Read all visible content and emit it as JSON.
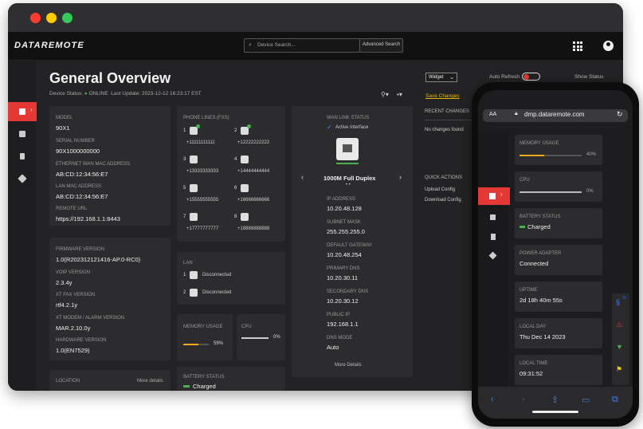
{
  "header": {
    "logo": "DATAREMOTE",
    "search_placeholder": "Device Search...",
    "advanced_search": "Advanced Search"
  },
  "overview": {
    "title": "General Overview",
    "status_label": "Device Status:",
    "status_value": "ONLINE",
    "last_update": "Last Update: 2023-12-12 16:23:17 EST",
    "widget_select": "Widget",
    "save_changes": "Save Changes",
    "auto_refresh": "Auto Refresh",
    "show_status": "Show Status"
  },
  "device": {
    "model_label": "MODEL",
    "model": "90X1",
    "serial_label": "SERIAL NUMBER",
    "serial": "90X1000000000",
    "eth_mac_label": "ETHERNET WAN MAC ADDRESS",
    "eth_mac": "AB:CD:12:34:56:E7",
    "lan_mac_label": "LAN MAC ADDRESS",
    "lan_mac": "AB:CD:12:34:56:E7",
    "remote_url_label": "REMOTE URL",
    "remote_url": "https://192.168.1.1:8443"
  },
  "firmware": {
    "fw_label": "FIRMWARE VERSION",
    "fw": "1.0(R202312121416-AP.0-RC0)",
    "voip_label": "VoIP VERSION",
    "voip": "2.3.4y",
    "fax_label": "XT FAX VERSION",
    "fax": "rtf4.2.1y",
    "modem_label": "XT MODEM / ALARM VERSION",
    "modem": "MAR.2.10.0y",
    "hw_label": "HARDWARE VERSION",
    "hw": "1.0(EN7529)"
  },
  "location": {
    "label": "LOCATION",
    "more": "More details"
  },
  "phone_lines": {
    "title": "PHONE LINES (FXS)",
    "lines": [
      {
        "n": "1",
        "num": "+11111111111"
      },
      {
        "n": "2",
        "num": "+12222222222"
      },
      {
        "n": "3",
        "num": "+13333333333"
      },
      {
        "n": "4",
        "num": "+14444444444"
      },
      {
        "n": "5",
        "num": "+15555555555"
      },
      {
        "n": "6",
        "num": "+16666666666"
      },
      {
        "n": "7",
        "num": "+17777777777"
      },
      {
        "n": "8",
        "num": "+18888888888"
      }
    ]
  },
  "lan": {
    "title": "LAN",
    "ports": [
      {
        "n": "1",
        "status": "Disconnected"
      },
      {
        "n": "2",
        "status": "Disconnected"
      }
    ]
  },
  "memory": {
    "label": "MEMORY USAGE",
    "value": "59%",
    "fraction": 0.59,
    "color": "#f5a623"
  },
  "cpu": {
    "label": "CPU",
    "value": "0%",
    "fraction": 0.0
  },
  "battery": {
    "label": "BATTERY STATUS",
    "value": "Charged",
    "color": "#4caf50"
  },
  "wan": {
    "title": "WAN LINK STATUS",
    "active": "Active Interface",
    "interface": "1000M Full Duplex",
    "ip_label": "IP ADDRESS",
    "ip": "10.20.48.128",
    "subnet_label": "SUBNET MASK",
    "subnet": "255.255.255.0",
    "gw_label": "DEFAULT GATEWAY",
    "gw": "10.20.48.254",
    "pdns_label": "PRIMARY DNS",
    "pdns": "10.20.30.11",
    "sdns_label": "SECONDARY DNS",
    "sdns": "10.20.30.12",
    "public_label": "PUBLIC IP",
    "public": "192.168.1.1",
    "dns_mode_label": "DNS MODE",
    "dns_mode": "Auto",
    "more": "More Details"
  },
  "recent": {
    "title": "RECENT CHANGES",
    "empty": "No changes found"
  },
  "quick": {
    "title": "QUICK ACTIONS",
    "upload": "Upload Config",
    "download": "Download Config"
  },
  "phone": {
    "aa": "AA",
    "url": "dmp.dataremote.com",
    "memory_label": "MEMORY USAGE",
    "memory_value": "40%",
    "memory_fraction": 0.4,
    "cpu_label": "CPU",
    "cpu_value": "0%",
    "cpu_fraction": 0.0,
    "battery_label": "BATTERY STATUS",
    "battery_value": "Charged",
    "power_label": "POWER ADAPTER",
    "power_value": "Connected",
    "uptime_label": "UPTIME",
    "uptime_value": "2d 18h 40m 55s",
    "day_label": "LOCAL DAY",
    "day_value": "Thu Dec 14 2023",
    "time_label": "LOCAL TIME",
    "time_value": "09:31:52",
    "badge_count": "0"
  },
  "colors": {
    "accent": "#e53935",
    "online": "#4caf50",
    "memory": "#f5a623",
    "link": "#e6b800"
  }
}
